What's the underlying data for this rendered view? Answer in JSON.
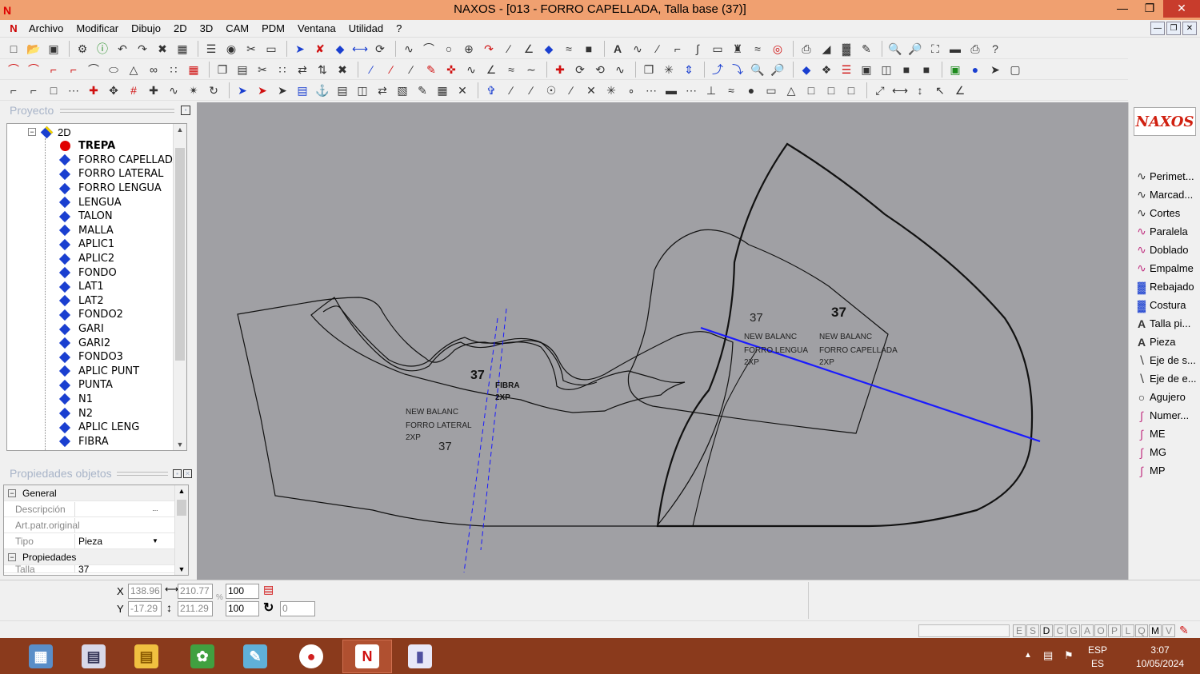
{
  "window": {
    "title": "NAXOS - [013 - FORRO CAPELLADA, Talla base (37)]",
    "app_icon": "naxos-logo-icon",
    "controls": [
      "minimize",
      "maximize",
      "close"
    ]
  },
  "menu": {
    "items": [
      "Archivo",
      "Modificar",
      "Dibujo",
      "2D",
      "3D",
      "CAM",
      "PDM",
      "Ventana",
      "Utilidad",
      "?"
    ]
  },
  "project_panel": {
    "title": "Proyecto",
    "root": "2D",
    "items": [
      {
        "label": "TREPA",
        "active": true
      },
      {
        "label": "FORRO CAPELLADA"
      },
      {
        "label": "FORRO LATERAL"
      },
      {
        "label": "FORRO LENGUA"
      },
      {
        "label": "LENGUA"
      },
      {
        "label": "TALON"
      },
      {
        "label": "MALLA"
      },
      {
        "label": "APLIC1"
      },
      {
        "label": "APLIC2"
      },
      {
        "label": "FONDO"
      },
      {
        "label": "LAT1"
      },
      {
        "label": "LAT2"
      },
      {
        "label": "FONDO2"
      },
      {
        "label": "GARI"
      },
      {
        "label": "GARI2"
      },
      {
        "label": "FONDO3"
      },
      {
        "label": "APLIC PUNT"
      },
      {
        "label": "PUNTA"
      },
      {
        "label": "N1"
      },
      {
        "label": "N2"
      },
      {
        "label": "APLIC LENG"
      },
      {
        "label": "FIBRA"
      }
    ]
  },
  "properties_panel": {
    "title": "Propiedades objetos",
    "section_general": "General",
    "rows": [
      {
        "name": "Descripción",
        "value": "",
        "button": "..."
      },
      {
        "name": "Art.patr.original",
        "value": ""
      },
      {
        "name": "Tipo",
        "value": "Pieza",
        "dropdown": true
      }
    ],
    "section_props": "Propiedades",
    "cut_row": "Talla",
    "cut_value": "37"
  },
  "canvas": {
    "labels": {
      "size_left": "37",
      "fibra": "FIBRA",
      "fibra_qty": "2XP",
      "lateral_brand": "NEW BALANC",
      "lateral_name": "FORRO LATERAL",
      "lateral_qty": "2XP",
      "lateral_size": "37",
      "lengua_size": "37",
      "lengua_brand": "NEW BALANC",
      "lengua_name": "FORRO LENGUA",
      "lengua_qty": "2XP",
      "capellada_size": "37",
      "capellada_brand": "NEW BALANC",
      "capellada_name": "FORRO CAPELLADA",
      "capellada_qty": "2XP"
    },
    "colors": {
      "background": "#a0a0a4",
      "selection": "#1a1aff"
    }
  },
  "right_panel": {
    "logo": "NAXOS",
    "tools": [
      {
        "label": "Perimet...",
        "icon": "curve-icon"
      },
      {
        "label": "Marcad...",
        "icon": "curve-icon"
      },
      {
        "label": "Cortes",
        "icon": "curve-icon"
      },
      {
        "label": "Paralela",
        "icon": "parallel-curve-icon"
      },
      {
        "label": "Doblado",
        "icon": "fold-curve-icon"
      },
      {
        "label": "Empalme",
        "icon": "join-curve-icon"
      },
      {
        "label": "Rebajado",
        "icon": "skive-icon"
      },
      {
        "label": "Costura",
        "icon": "seam-icon"
      },
      {
        "label": "Talla pi...",
        "icon": "text-icon"
      },
      {
        "label": "Pieza",
        "icon": "text-icon"
      },
      {
        "label": "Eje de s...",
        "icon": "axis-icon"
      },
      {
        "label": "Eje de e...",
        "icon": "axis-icon"
      },
      {
        "label": "Agujero",
        "icon": "hole-icon"
      },
      {
        "label": "Numer...",
        "icon": "number-icon"
      },
      {
        "label": "ME",
        "icon": "mark-icon"
      },
      {
        "label": "MG",
        "icon": "mark-icon"
      },
      {
        "label": "MP",
        "icon": "mark-icon"
      }
    ]
  },
  "coords": {
    "x_label": "X",
    "y_label": "Y",
    "x": "138.96",
    "y": "-17.29",
    "w": "210.77",
    "h": "211.29",
    "scale_x": "100",
    "scale_y": "100",
    "rotation": "0",
    "percent": "%"
  },
  "status": {
    "letters": [
      "E",
      "S",
      "D",
      "C",
      "G",
      "A",
      "O",
      "P",
      "L",
      "Q",
      "M",
      "V"
    ],
    "active_letters": [
      "D",
      "M"
    ]
  },
  "taskbar": {
    "apps": [
      "calculator-icon",
      "media-icon",
      "file-explorer-icon",
      "corel-icon",
      "notes-icon",
      "chrome-icon",
      "naxos-icon",
      "app-icon"
    ],
    "lang_top": "ESP",
    "lang_bottom": "ES",
    "time": "3:07",
    "date": "10/05/2024"
  }
}
